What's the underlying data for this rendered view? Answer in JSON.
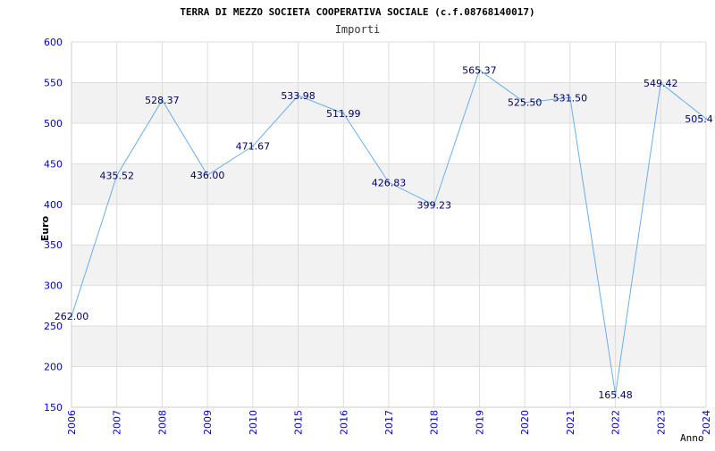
{
  "chart_data": {
    "type": "line",
    "title": "TERRA DI MEZZO SOCIETA COOPERATIVA SOCIALE (c.f.08768140017)",
    "subtitle": "Importi",
    "ylabel": "Euro",
    "xlabel": "Anno",
    "ylim": [
      150,
      600
    ],
    "y_ticks": [
      "150",
      "200",
      "250",
      "300",
      "350",
      "400",
      "450",
      "500",
      "550",
      "600"
    ],
    "categories": [
      "2006",
      "2007",
      "2008",
      "2009",
      "2010",
      "2015",
      "2016",
      "2017",
      "2018",
      "2019",
      "2020",
      "2021",
      "2022",
      "2023",
      "2024"
    ],
    "values": [
      262.0,
      435.52,
      528.37,
      436.0,
      471.67,
      533.98,
      511.99,
      426.83,
      399.23,
      565.37,
      525.5,
      531.5,
      165.48,
      549.42,
      505.4
    ],
    "data_labels": [
      "262.00",
      "435.52",
      "528.37",
      "436.00",
      "471.67",
      "533.98",
      "511.99",
      "426.83",
      "399.23",
      "565.37",
      "525.50",
      "531.50",
      "165.48",
      "549.42",
      "505.4"
    ],
    "grid": true,
    "colors": {
      "line": "#6aaee8",
      "band": "#f2f2f2",
      "gridline": "#dddddd",
      "axis_text": "#0000cc",
      "label_text": "#000066",
      "title_text": "#000000"
    }
  }
}
